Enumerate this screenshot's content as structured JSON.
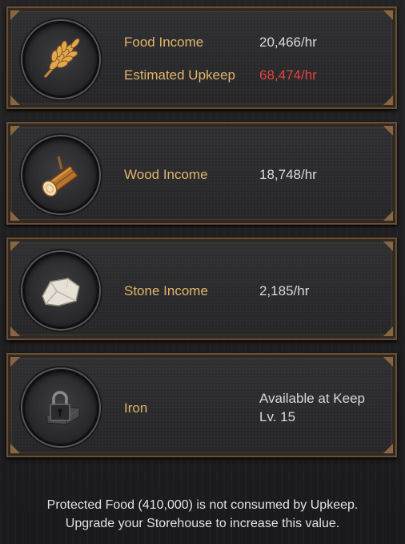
{
  "resources": [
    {
      "id": "food",
      "icon": "wheat-icon",
      "rows": [
        {
          "label": "Food Income",
          "value": "20,466/hr",
          "color": "#d8d8d8"
        },
        {
          "label": "Estimated Upkeep",
          "value": "68,474/hr",
          "color": "#e0443a"
        }
      ]
    },
    {
      "id": "wood",
      "icon": "log-icon",
      "rows": [
        {
          "label": "Wood Income",
          "value": "18,748/hr",
          "color": "#d8d8d8"
        }
      ]
    },
    {
      "id": "stone",
      "icon": "stone-icon",
      "rows": [
        {
          "label": "Stone Income",
          "value": "2,185/hr",
          "color": "#d8d8d8"
        }
      ]
    },
    {
      "id": "iron",
      "icon": "locked-iron-icon",
      "rows": [
        {
          "label": "Iron",
          "value_line1": "Available at Keep",
          "value_line2": "Lv. 15",
          "color": "#d8d8d8"
        }
      ]
    }
  ],
  "footer": {
    "line1": "Protected Food (410,000) is not consumed by Upkeep.",
    "line2": "Upgrade your Storehouse to increase this value."
  },
  "colors": {
    "label_gold": "#e1b46b",
    "value_white": "#d8d8d8",
    "warning_red": "#e0443a",
    "frame_bronze": "#6b4e31"
  }
}
